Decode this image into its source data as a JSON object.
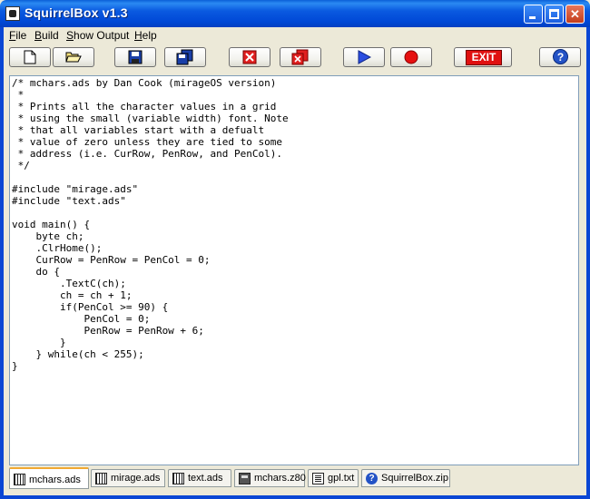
{
  "window": {
    "title": "SquirrelBox v1.3"
  },
  "menu": [
    {
      "label": "File",
      "accel": "F",
      "rest": "ile"
    },
    {
      "label": "Build",
      "accel": "B",
      "rest": "uild"
    },
    {
      "label": "Show Output",
      "accel": "S",
      "rest": "how Output"
    },
    {
      "label": "Help",
      "accel": "H",
      "rest": "elp"
    }
  ],
  "toolbar": {
    "exit_label": "EXIT",
    "help_label": "?"
  },
  "editor": {
    "code": "/* mchars.ads by Dan Cook (mirageOS version)\n *\n * Prints all the character values in a grid\n * using the small (variable width) font. Note\n * that all variables start with a defualt\n * value of zero unless they are tied to some\n * address (i.e. CurRow, PenRow, and PenCol).\n */\n\n#include \"mirage.ads\"\n#include \"text.ads\"\n\nvoid main() {\n    byte ch;\n    .ClrHome();\n    CurRow = PenRow = PenCol = 0;\n    do {\n        .TextC(ch);\n        ch = ch + 1;\n        if(PenCol >= 90) {\n            PenCol = 0;\n            PenRow = PenRow + 6;\n        }\n    } while(ch < 255);\n}"
  },
  "tabs": [
    {
      "label": "mchars.ads",
      "icon": "grid-icon",
      "active": true
    },
    {
      "label": "mirage.ads",
      "icon": "grid-icon",
      "active": false
    },
    {
      "label": "text.ads",
      "icon": "grid-icon",
      "active": false
    },
    {
      "label": "mchars.z80",
      "icon": "calculator-icon",
      "active": false
    },
    {
      "label": "gpl.txt",
      "icon": "document-icon",
      "active": false
    },
    {
      "label": "SquirrelBox.zip",
      "icon": "help-icon",
      "active": false
    }
  ]
}
